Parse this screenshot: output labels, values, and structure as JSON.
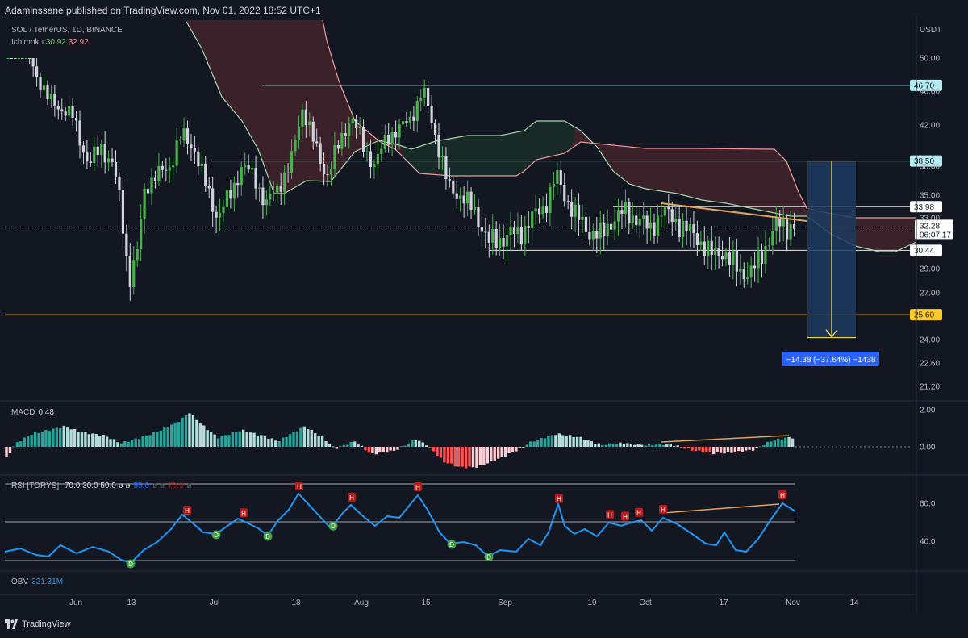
{
  "header": {
    "published": "Adaminssane published on TradingView.com, Nov 01, 2022 18:52 UTC+1"
  },
  "legend": {
    "symbol": "SOL / TetherUS, 1D, BINANCE",
    "ichimoku_label": "Ichimoku",
    "ichimoku_v1": "30.92",
    "ichimoku_v2": "32.92"
  },
  "panes": {
    "macd": {
      "label": "MACD",
      "value": "0.48"
    },
    "rsi": {
      "label": "RSI [TORYS]",
      "params": "70.0  30.0  50.0  ø  ø",
      "param_blue": "55.0",
      "tail": "ø  ø",
      "param_red": "70.0",
      "end": "ø"
    },
    "obv": {
      "label": "OBV",
      "value": "321.31M"
    }
  },
  "footer": {
    "brand": "TradingView"
  },
  "colors": {
    "bg": "#131722",
    "up": "#4caf50",
    "down": "#d1d4dc",
    "kumo_bear": "#5d2a32",
    "kumo_bull": "#1e3a2e",
    "tenkan": "#a5d6a7",
    "kijun": "#ef9a9a",
    "rsi": "#2196f3",
    "trend": "#e0a35a",
    "measure": "#1e3a5f"
  },
  "chart_data": [
    {
      "type": "candlestick",
      "title": "SOL / TetherUS, 1D, BINANCE",
      "currency": "USDT",
      "y_ticks": [
        "50.00",
        "46.00",
        "42.00",
        "38.00",
        "35.00",
        "33.00",
        "29.00",
        "27.00",
        "24.00",
        "22.60",
        "21.20"
      ],
      "x_ticks": [
        "Jun",
        "13",
        "Jul",
        "18",
        "Aug",
        "15",
        "Sep",
        "19",
        "Oct",
        "17",
        "Nov",
        "14"
      ],
      "current_price": "32.28",
      "countdown": "06:07:17",
      "levels": [
        {
          "label": "46.70",
          "value": 46.7,
          "color": "#b2ebf2"
        },
        {
          "label": "38.50",
          "value": 38.5,
          "color": "#b2ebf2"
        },
        {
          "label": "33.98",
          "value": 33.98,
          "color": "#ffffff"
        },
        {
          "label": "30.44",
          "value": 30.44,
          "color": "#ffffff"
        },
        {
          "label": "25.60",
          "value": 25.6,
          "color": "#ffca28"
        }
      ],
      "measurement": {
        "label": "−14.38 (−37.64%) −1438",
        "from": 38.5,
        "to": 24.12
      },
      "annotations": [
        "descending trendline from Oct 3 high to Nov 1"
      ],
      "indicator": "Ichimoku"
    },
    {
      "type": "histogram",
      "name": "MACD",
      "y_ticks": [
        "2.00",
        "0.00"
      ]
    },
    {
      "type": "line",
      "name": "RSI",
      "y_ticks": [
        "60.0",
        "40.0"
      ],
      "bands": [
        70,
        50,
        30
      ],
      "markers_H": 10,
      "markers_D": 6
    }
  ]
}
